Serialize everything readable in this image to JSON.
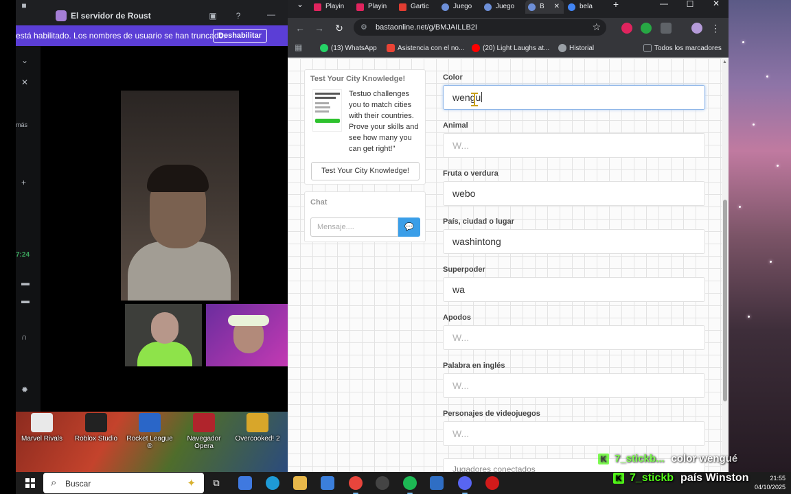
{
  "discord": {
    "window_title": "El servidor de Roust",
    "notice_text": "está habilitado. Los nombres de usuario se han truncado.",
    "notice_button": "Deshabilitar",
    "rail_label": "más",
    "rail_time": "7:24",
    "desktop_icons": [
      {
        "label": "Marvel Rivals"
      },
      {
        "label": "Roblox Studio"
      },
      {
        "label": "Rocket League ®"
      },
      {
        "label": "Navegador Opera"
      },
      {
        "label": "Overcooked! 2"
      }
    ]
  },
  "browser": {
    "tabs": [
      {
        "label": "Playin",
        "color": "#e0245e"
      },
      {
        "label": "Playin",
        "color": "#e0245e"
      },
      {
        "label": "Gartic",
        "color": "#e03c31"
      },
      {
        "label": "Juego",
        "color": "#6d8fd8"
      },
      {
        "label": "Juego",
        "color": "#6d8fd8"
      },
      {
        "label": "B",
        "color": "#6d8fd8"
      },
      {
        "label": "bela",
        "color": "#4285f4"
      }
    ],
    "new_tab": "+",
    "url": "bastaonline.net/g/BMJAILLB2I",
    "bookmarks": [
      {
        "label": "(13) WhatsApp",
        "color": "#25d366"
      },
      {
        "label": "Asistencia con el no...",
        "color": "#ea4335"
      },
      {
        "label": "(20) Light Laughs at...",
        "color": "#ff0000"
      },
      {
        "label": "Historial",
        "color": "#9aa0a6"
      }
    ],
    "all_bookmarks": "Todos los marcadores"
  },
  "page": {
    "ad": {
      "title": "Test Your City Knowledge!",
      "description": "Testuo challenges you to match cities with their countries. Prove your skills and see how many you can get right!\"",
      "button": "Test Your City Knowledge!"
    },
    "chat": {
      "title": "Chat",
      "placeholder": "Mensaje...."
    },
    "fields": [
      {
        "label": "Color",
        "value": "wengu",
        "placeholder": "",
        "focused": true
      },
      {
        "label": "Animal",
        "value": "",
        "placeholder": "W..."
      },
      {
        "label": "Fruta o verdura",
        "value": "webo",
        "placeholder": ""
      },
      {
        "label": "País, ciudad o lugar",
        "value": "washintong",
        "placeholder": ""
      },
      {
        "label": "Superpoder",
        "value": "wa",
        "placeholder": ""
      },
      {
        "label": "Apodos",
        "value": "",
        "placeholder": "W..."
      },
      {
        "label": "Palabra en inglés",
        "value": "",
        "placeholder": "W..."
      },
      {
        "label": "Personajes de videojuegos",
        "value": "",
        "placeholder": "W..."
      }
    ],
    "footer_partial": "Jugadores conectados"
  },
  "overlay": {
    "messages": [
      {
        "badge": "K",
        "user": "7_stickb...",
        "text": "color wengué"
      },
      {
        "badge": "K",
        "user": "7_stickb",
        "text": "país Winston"
      }
    ]
  },
  "taskbar": {
    "search_placeholder": "Buscar",
    "time": "21:55",
    "date": "04/10/2025"
  },
  "colors": {
    "discord_notice": "#5b3ed6",
    "chat_send": "#3a9ee8",
    "kick_green": "#53fc18"
  }
}
